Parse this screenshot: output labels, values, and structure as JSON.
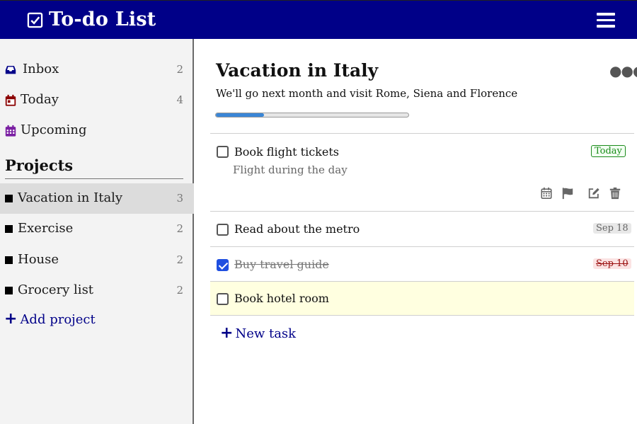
{
  "app": {
    "title": "To-do List"
  },
  "sidebar": {
    "nav": [
      {
        "label": "Inbox",
        "count": "2",
        "icon": "inbox-icon",
        "color": "#000088"
      },
      {
        "label": "Today",
        "count": "4",
        "icon": "calendar-today-icon",
        "color": "#8b0000"
      },
      {
        "label": "Upcoming",
        "count": "",
        "icon": "calendar-upcoming-icon",
        "color": "#7a1fa2"
      }
    ],
    "projects_heading": "Projects",
    "projects": [
      {
        "label": "Vacation in Italy",
        "count": "3",
        "active": true
      },
      {
        "label": "Exercise",
        "count": "2"
      },
      {
        "label": "House",
        "count": "2"
      },
      {
        "label": "Grocery list",
        "count": "2"
      }
    ],
    "add_project": "Add project"
  },
  "main": {
    "title": "Vacation in Italy",
    "description": "We'll go next month and visit Rome, Siena and Florence",
    "progress": 0.25,
    "more_icon": "more-horizontal-icon",
    "tasks": [
      {
        "title": "Book flight tickets",
        "note": "Flight during the day",
        "badge": "Today",
        "badge_type": "today",
        "done": false,
        "expanded": true
      },
      {
        "title": "Read about the metro",
        "badge": "Sep 18",
        "badge_type": "date",
        "done": false
      },
      {
        "title": "Buy travel guide",
        "badge": "Sep 10",
        "badge_type": "overdue",
        "done": true
      },
      {
        "title": "Book hotel room",
        "badge": "",
        "done": false,
        "highlighted": true,
        "highlight_color": "#ffffe0"
      }
    ],
    "new_task": "New task"
  },
  "colors": {
    "header": "#000088",
    "accent": "#000088",
    "progress": "#3a86d6",
    "checkbox_checked": "#1f4fe0"
  }
}
